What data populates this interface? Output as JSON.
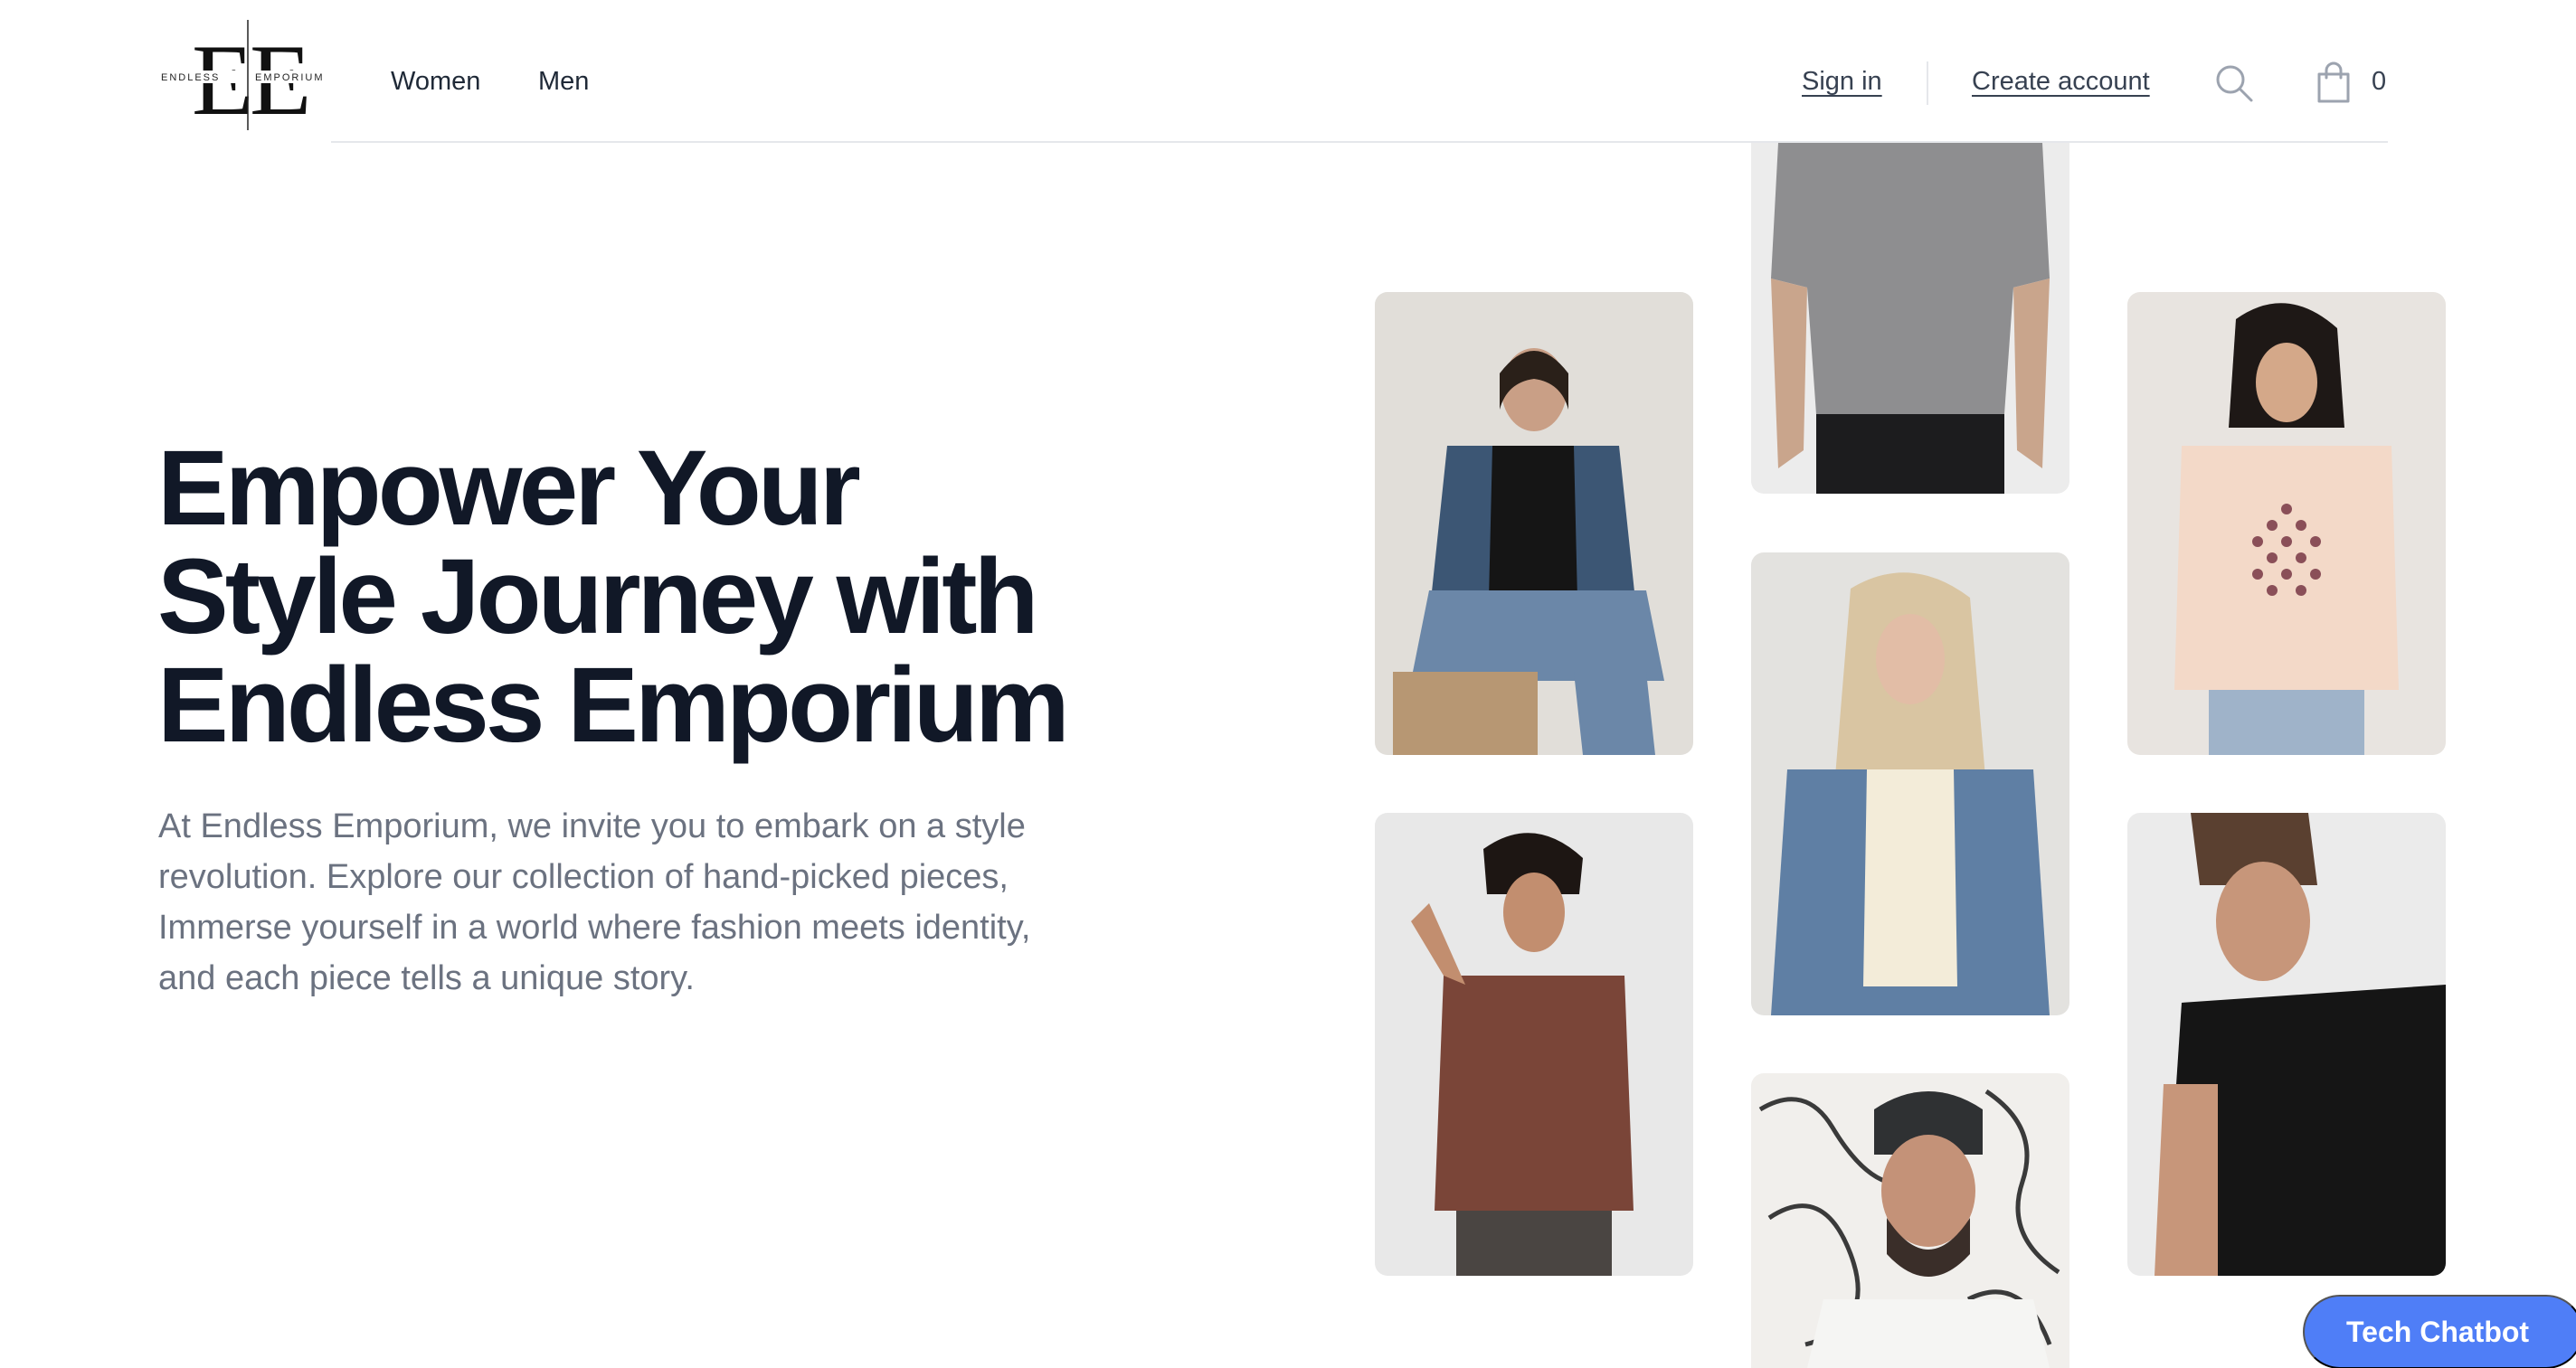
{
  "brand": {
    "monogram": "EE",
    "left_word": "ENDLESS",
    "right_word": "EMPORIUM"
  },
  "nav": {
    "items": [
      {
        "label": "Women"
      },
      {
        "label": "Men"
      }
    ]
  },
  "account": {
    "sign_in": "Sign in",
    "create_account": "Create account"
  },
  "cart": {
    "count": "0"
  },
  "hero": {
    "title_lines": [
      "Empower Your",
      "Style Journey with",
      "Endless Emporium"
    ],
    "description_lines": [
      "At Endless Emporium, we invite you to embark on a style",
      "revolution. Explore our collection of hand-picked pieces,",
      "Immerse yourself in a world where fashion meets identity,",
      "and each piece tells a unique story."
    ]
  },
  "gallery": [
    {
      "name": "model-grey-tee"
    },
    {
      "name": "model-denim-jacket-black-tee"
    },
    {
      "name": "model-peach-dotted-tee"
    },
    {
      "name": "model-blonde-denim-jacket"
    },
    {
      "name": "model-brown-tee"
    },
    {
      "name": "model-black-tee-beard"
    },
    {
      "name": "model-beanie-glasses"
    }
  ],
  "chatbot": {
    "label": "Tech Chatbot"
  },
  "colors": {
    "heading": "#111827",
    "body_text": "#6b7280",
    "chatbot_bg": "#4f7ef7"
  }
}
